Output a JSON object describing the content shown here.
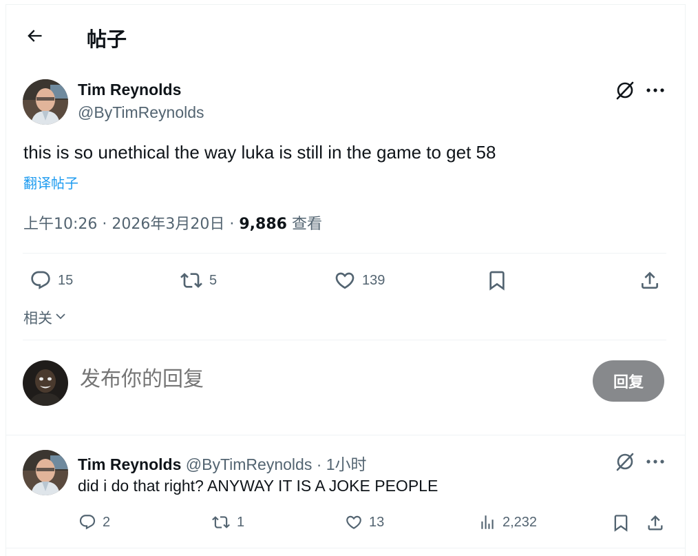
{
  "header": {
    "title": "帖子"
  },
  "post": {
    "author_name": "Tim Reynolds",
    "author_handle": "@ByTimReynolds",
    "text": "this is so unethical the way luka is still in the game to get 58",
    "translate_label": "翻译帖子",
    "time": "上午10:26",
    "date": "2026年3月20日",
    "separator": " · ",
    "views_count": "9,886",
    "views_label": "查看",
    "actions": {
      "replies": "15",
      "reposts": "5",
      "likes": "139"
    }
  },
  "related_label": "相关",
  "reply_box": {
    "placeholder": "发布你的回复",
    "button_label": "回复"
  },
  "reply": {
    "author_name": "Tim Reynolds",
    "author_handle": "@ByTimReynolds",
    "time": "· 1小时",
    "text": "did i do that right? ANYWAY IT IS A JOKE PEOPLE",
    "actions": {
      "replies": "2",
      "reposts": "1",
      "likes": "13",
      "views": "2,232"
    }
  },
  "colors": {
    "link": "#1d9bf0",
    "muted": "#536471",
    "reply_button_bg": "#87898c"
  }
}
